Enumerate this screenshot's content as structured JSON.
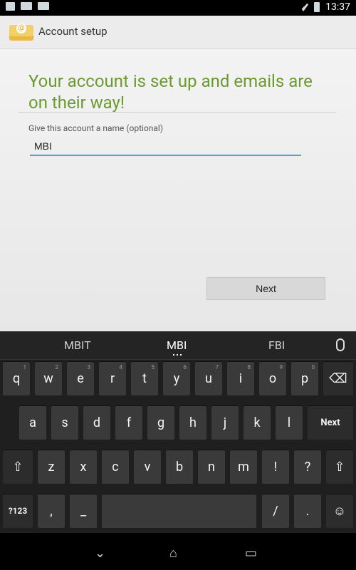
{
  "status": {
    "time": "13:37"
  },
  "actionbar": {
    "title": "Account setup"
  },
  "content": {
    "heading": "Your account is set up and emails are on their way!",
    "label": "Give this account a name (optional)",
    "input_value": "MBI",
    "button_label": "Next"
  },
  "keyboard": {
    "suggestions": [
      "MBIT",
      "MBI",
      "FBI"
    ],
    "row1": [
      "q",
      "w",
      "e",
      "r",
      "t",
      "y",
      "u",
      "i",
      "o",
      "p"
    ],
    "row1_hints": [
      "1",
      "2",
      "3",
      "4",
      "5",
      "6",
      "7",
      "8",
      "9",
      "0"
    ],
    "row2": [
      "a",
      "s",
      "d",
      "f",
      "g",
      "h",
      "j",
      "k",
      "l"
    ],
    "row2_action": "Next",
    "row3": [
      "z",
      "x",
      "c",
      "v",
      "b",
      "n",
      "m",
      "!",
      "?"
    ],
    "symbols": "?123",
    "comma": ",",
    "underscore": "_",
    "slash": "/",
    "period": "."
  },
  "icons": {
    "app": "email-app-icon",
    "mic": "mic-icon",
    "shift": "shift-icon",
    "backspace": "backspace-icon",
    "emoji": "emoji-icon",
    "back": "back-icon",
    "home": "home-icon",
    "recent": "recent-apps-icon"
  }
}
